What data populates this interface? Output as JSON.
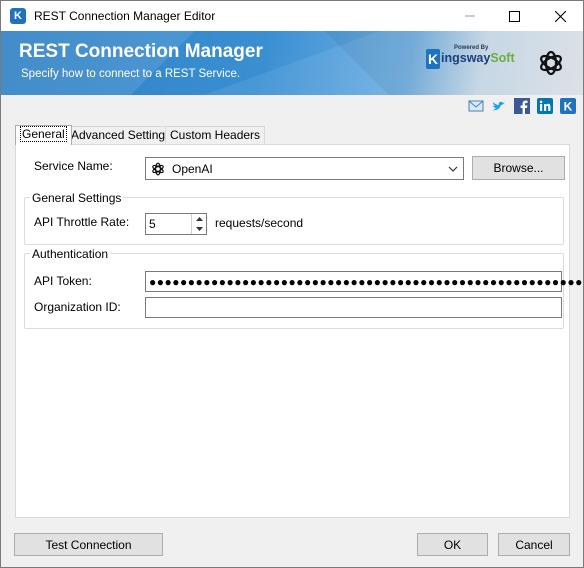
{
  "window": {
    "title": "REST Connection Manager Editor",
    "icon_letter": "K"
  },
  "banner": {
    "title": "REST Connection Manager",
    "subtitle": "Specify how to connect to a REST Service.",
    "brand_powered": "Powered By",
    "brand_k": "K",
    "brand_name_1": "ingsway",
    "brand_name_2": "Soft"
  },
  "social_icons": [
    "mail-icon",
    "twitter-icon",
    "facebook-icon",
    "linkedin-icon",
    "kingswaysoft-icon"
  ],
  "tabs": [
    {
      "label": "General",
      "active": true
    },
    {
      "label": "Advanced Settings",
      "active": false
    },
    {
      "label": "Custom Headers",
      "active": false
    }
  ],
  "service": {
    "label": "Service Name:",
    "value": "OpenAI",
    "browse_label": "Browse..."
  },
  "general_settings": {
    "title": "General Settings",
    "throttle_label": "API Throttle Rate:",
    "throttle_value": "5",
    "throttle_unit": "requests/second"
  },
  "authentication": {
    "title": "Authentication",
    "token_label": "API Token:",
    "token_value": "●●●●●●●●●●●●●●●●●●●●●●●●●●●●●●●●●●●●●●●●●●●●●●●●●●●●●●●●",
    "org_label": "Organization ID:",
    "org_value": ""
  },
  "footer": {
    "test_label": "Test Connection",
    "ok_label": "OK",
    "cancel_label": "Cancel"
  },
  "colors": {
    "brand_blue": "#1e73be",
    "brand_green": "#6ab03b",
    "twitter": "#1da1f2",
    "facebook": "#3b5998",
    "linkedin": "#0077b5"
  }
}
